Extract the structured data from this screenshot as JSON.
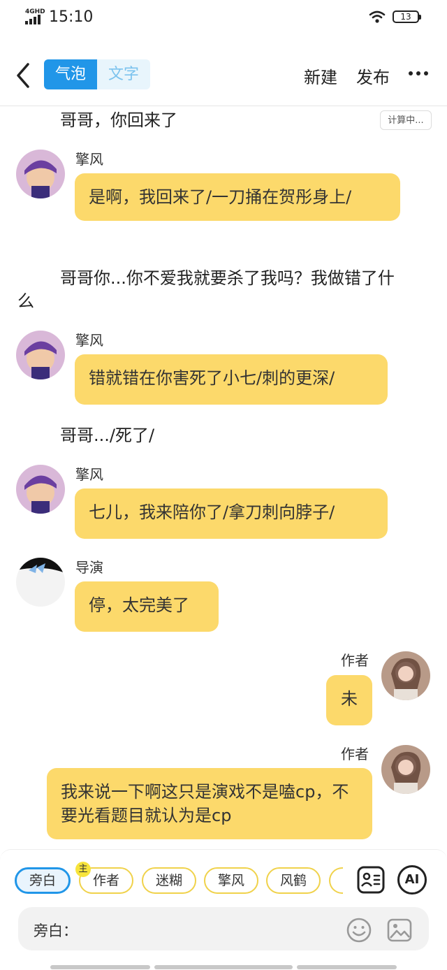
{
  "status": {
    "network": "4GHD",
    "time": "15:10",
    "battery": "13"
  },
  "nav": {
    "tab_bubble": "气泡",
    "tab_text": "文字",
    "new_label": "新建",
    "publish_label": "发布"
  },
  "calc_label": "计算中...",
  "messages": [
    {
      "type": "narration",
      "text": "哥哥，你回来了"
    },
    {
      "type": "left",
      "name": "擎风",
      "text": "是啊，我回来了/一刀捅在贺彤身上/"
    },
    {
      "type": "narration",
      "text": "哥哥你...你不爱我就要杀了我吗？我做错了什么"
    },
    {
      "type": "left",
      "name": "擎风",
      "text": "错就错在你害死了小七/刺的更深/"
    },
    {
      "type": "narration",
      "text": "哥哥.../死了/"
    },
    {
      "type": "left",
      "name": "擎风",
      "text": "七儿，我来陪你了/拿刀刺向脖子/"
    },
    {
      "type": "left",
      "name": "导演",
      "text": "停，太完美了"
    },
    {
      "type": "right",
      "name": "作者",
      "text": "未"
    },
    {
      "type": "right",
      "name": "作者",
      "text": "我来说一下啊这只是演戏不是嗑cp，不要光看题目就认为是cp"
    }
  ],
  "roles": [
    "旁白",
    "作者",
    "迷糊",
    "擎风",
    "风鹤"
  ],
  "role_badge": "主",
  "ai_label": "AI",
  "input": {
    "label": "旁白："
  },
  "colors": {
    "accent": "#2196e8",
    "bubble": "#fcd96b",
    "chip_border": "#f0d24b"
  },
  "icons": [
    "back-chevron-icon",
    "more-icon",
    "wifi-icon",
    "role-card-icon",
    "emoji-icon",
    "image-icon"
  ]
}
